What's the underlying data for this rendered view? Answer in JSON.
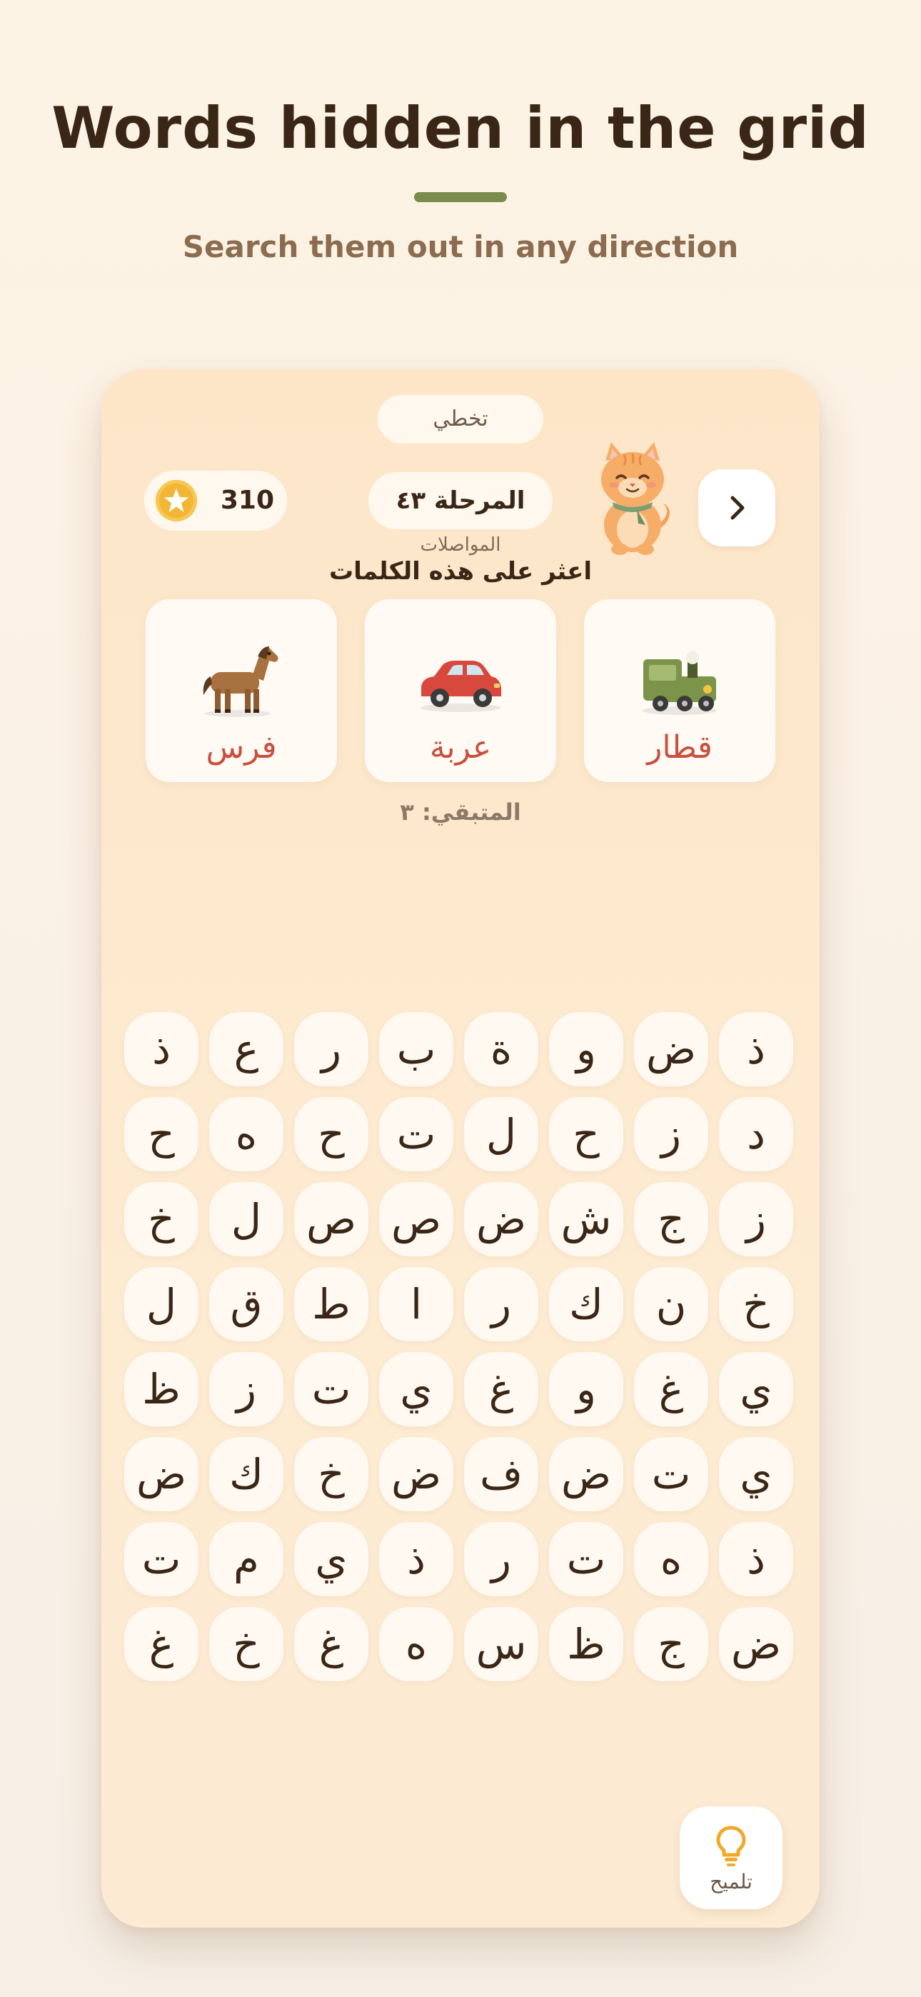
{
  "header": {
    "title": "Words hidden in the grid",
    "subtitle": "Search them out in any direction"
  },
  "game": {
    "skip_label": "تخطي",
    "coins": "310",
    "level_label": "المرحلة ٤٣",
    "category": "المواصلات",
    "find_words_label": "اعثر على هذه الكلمات",
    "remaining_label": "المتبقي: ٣",
    "hint_label": "تلميح",
    "target_words": [
      {
        "label": "قطار",
        "icon": "train-icon"
      },
      {
        "label": "عربة",
        "icon": "car-icon"
      },
      {
        "label": "فرس",
        "icon": "horse-icon"
      }
    ],
    "grid_rows": [
      [
        "ذ",
        "ض",
        "و",
        "ة",
        "ب",
        "ر",
        "ع",
        "ذ"
      ],
      [
        "د",
        "ز",
        "ح",
        "ل",
        "ت",
        "ح",
        "ه",
        "ح"
      ],
      [
        "ز",
        "ج",
        "ش",
        "ض",
        "ص",
        "ص",
        "ل",
        "خ"
      ],
      [
        "خ",
        "ن",
        "ك",
        "ر",
        "ا",
        "ط",
        "ق",
        "ل"
      ],
      [
        "ي",
        "غ",
        "و",
        "غ",
        "ي",
        "ت",
        "ز",
        "ظ"
      ],
      [
        "ي",
        "ت",
        "ض",
        "ف",
        "ض",
        "خ",
        "ك",
        "ض"
      ],
      [
        "ذ",
        "ه",
        "ت",
        "ر",
        "ذ",
        "ي",
        "م",
        "ت"
      ],
      [
        "ض",
        "ج",
        "ظ",
        "س",
        "ه",
        "غ",
        "خ",
        "غ"
      ]
    ]
  },
  "colors": {
    "accent_green": "#7a8b4c",
    "word_red": "#c8503e",
    "coin_gold": "#f3b634"
  }
}
